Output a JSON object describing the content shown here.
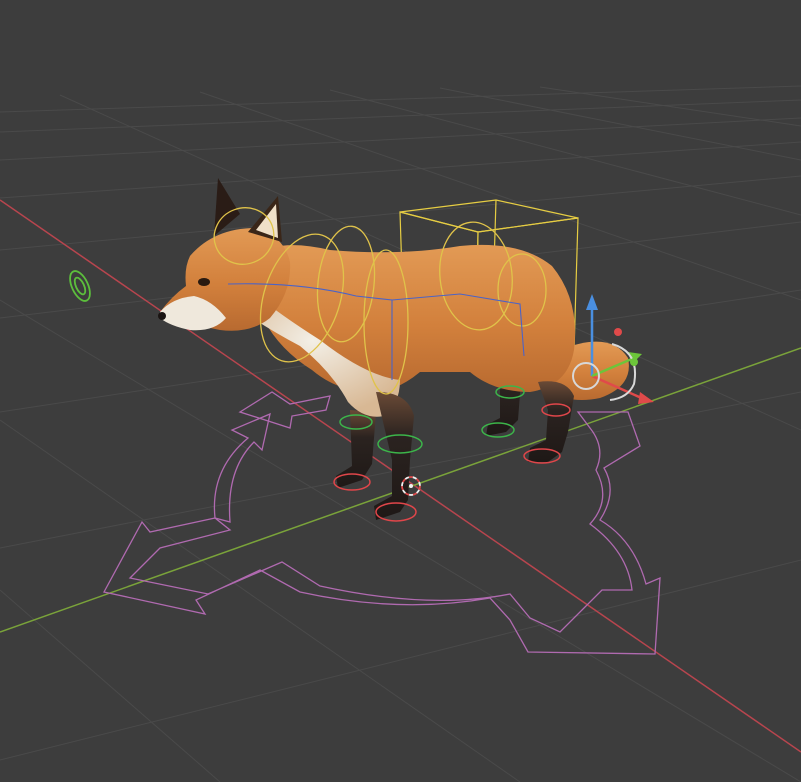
{
  "viewport": {
    "background": "#3d3d3d",
    "grid_color": "#4a4a4a",
    "x_axis_color": "#b8454e",
    "y_axis_color": "#7aa33a"
  },
  "scene_object": {
    "fur_color": "#d9863f",
    "fur_light": "#eeeae0",
    "leg_color": "#2b2320"
  },
  "rig": {
    "main_control_color": "#b06ab0",
    "spine_control_color": "#e0c34a",
    "hip_box_color": "#e6cd43",
    "bone_color": "#4b63c7",
    "ik_left_color": "#e0464a",
    "ik_right_color": "#3cb54a",
    "offscreen_control_color": "#5cbf3c"
  },
  "gizmo": {
    "z_axis_color": "#4a8fe0",
    "x_axis_color": "#e04a4a",
    "y_axis_color": "#6cc53a",
    "ring_color": "#d8d8d8"
  },
  "cursor_3d": {
    "color_a": "#e04a4a",
    "color_b": "#f0f0f0"
  }
}
